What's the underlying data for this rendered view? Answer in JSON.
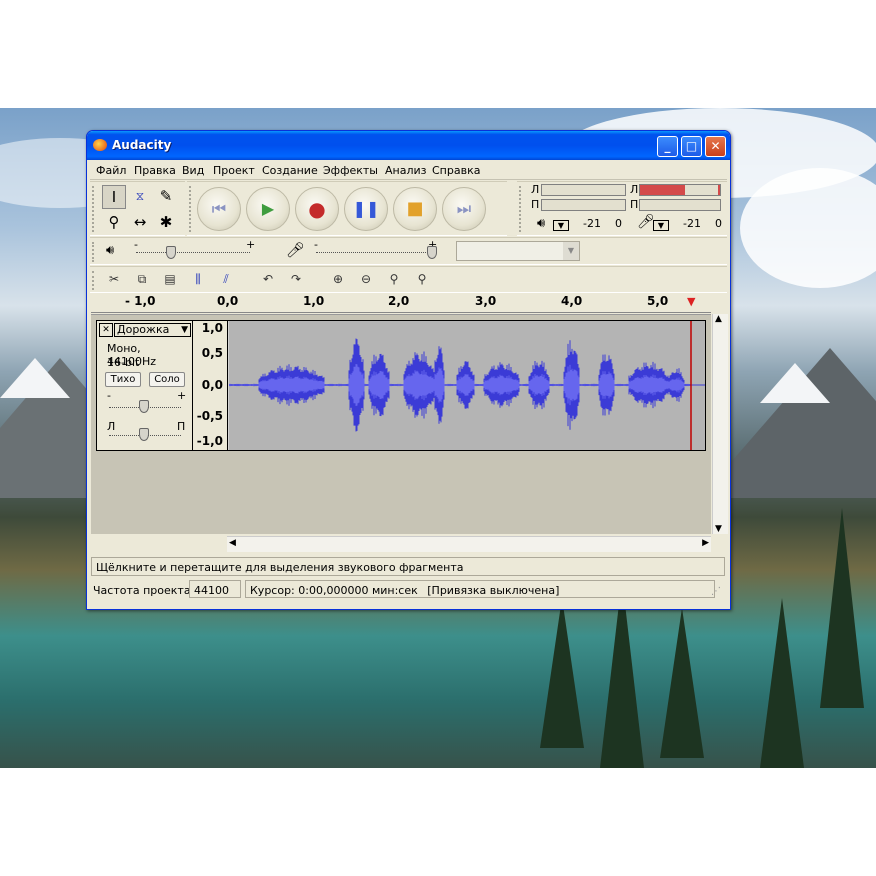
{
  "window": {
    "title": "Audacity"
  },
  "menu": [
    "Файл",
    "Правка",
    "Вид",
    "Проект",
    "Создание",
    "Эффекты",
    "Анализ",
    "Справка"
  ],
  "tools": [
    "select-tool",
    "envelope-tool",
    "draw-tool",
    "zoom-tool",
    "timeshift-tool",
    "multi-tool"
  ],
  "meters": {
    "left_label": "Л",
    "right_label": "П",
    "scale_mid": "-21",
    "scale_end": "0",
    "playback_level_right": 0.55
  },
  "mixer": {
    "minus": "-",
    "plus": "+",
    "input_select": ""
  },
  "ruler": {
    "labels": [
      "- 1,0",
      "0,0",
      "1,0",
      "2,0",
      "3,0",
      "4,0",
      "5,0"
    ]
  },
  "track": {
    "close": "✕",
    "name": "Дорожка",
    "format": "Моно, 44100Hz",
    "bits": "16-bit",
    "mute": "Тихо",
    "solo": "Соло",
    "gain_minus": "-",
    "gain_plus": "+",
    "pan_left": "Л",
    "pan_right": "П",
    "scale": [
      "1,0",
      "0,5",
      "0,0",
      "-0,5",
      "-1,0"
    ]
  },
  "status": {
    "message": "Щёлкните и перетащите для выделения звукового фрагмента",
    "rate_label": "Частота проекта:",
    "rate_value": "44100",
    "cursor": "Курсор: 0:00,000000 мин:сек",
    "snap": "[Привязка выключена]"
  },
  "colors": {
    "waveform": "#3b3bd6",
    "waveform_rms": "#6666ee",
    "titlebar": "#0050ee",
    "cursor_line": "#c00000"
  }
}
